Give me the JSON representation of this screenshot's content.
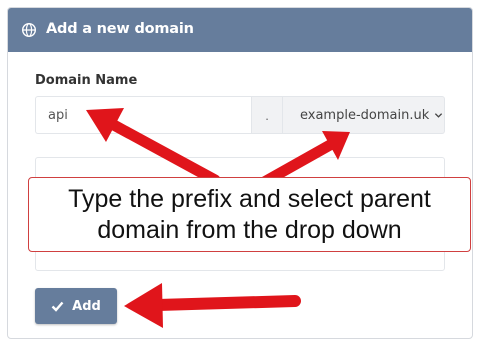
{
  "header": {
    "title": "Add a new domain",
    "icon": "globe-icon"
  },
  "form": {
    "domain_label": "Domain Name",
    "prefix_value": "api",
    "separator": ".",
    "parent_domain_selected": "example-domain.uk",
    "add_button_label": "Add"
  },
  "annotation": {
    "callout_text": "Type the prefix and select parent domain from the drop down",
    "arrow_color": "#e0151b"
  },
  "colors": {
    "header_bg": "#667d9c",
    "button_bg": "#667d9c"
  }
}
